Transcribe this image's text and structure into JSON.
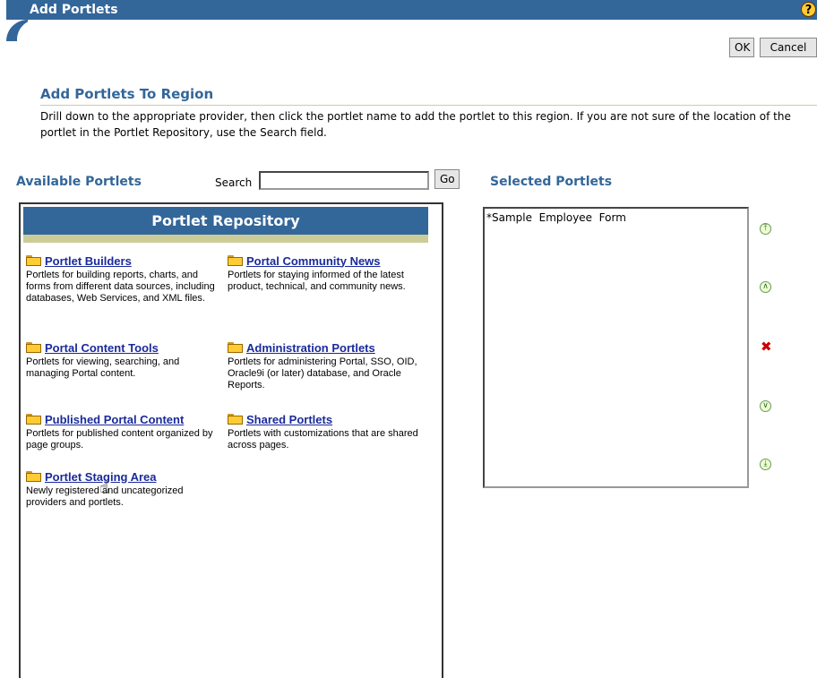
{
  "dialog": {
    "title": "Add Portlets",
    "help_glyph": "?"
  },
  "buttons": {
    "ok": "OK",
    "cancel": "Cancel",
    "go": "Go"
  },
  "section": {
    "title": "Add Portlets To Region",
    "instructions": "Drill down to the appropriate provider, then click the portlet name to add the portlet to this region. If you are not sure of the location of the portlet in the Portlet Repository, use the Search field."
  },
  "available": {
    "label": "Available Portlets",
    "search_label": "Search",
    "search_value": ""
  },
  "repository": {
    "header": "Portlet Repository",
    "providers": [
      {
        "name": "Portlet Builders",
        "desc": "Portlets for building reports, charts, and forms from different data sources, including databases, Web Services, and XML files."
      },
      {
        "name": "Portal Community News",
        "desc": "Portlets for staying informed of the latest product, technical, and community news."
      },
      {
        "name": "Portal Content Tools",
        "desc": "Portlets for viewing, searching, and managing Portal content."
      },
      {
        "name": "Administration Portlets",
        "desc": "Portlets for administering Portal, SSO, OID, Oracle9i (or later) database, and Oracle Reports."
      },
      {
        "name": "Published Portal Content",
        "desc": "Portlets for published content organized by page groups."
      },
      {
        "name": "Shared Portlets",
        "desc": "Portlets with customizations that are shared across pages."
      },
      {
        "name": "Portlet Staging Area",
        "desc": "Newly registered and uncategorized providers and portlets."
      }
    ]
  },
  "selected": {
    "label": "Selected Portlets",
    "items": [
      "*Sample  Employee  Form"
    ]
  },
  "move_controls": {
    "top": "⤒",
    "up": "∧",
    "remove": "✖",
    "down": "∨",
    "bottom": "⤓"
  },
  "colors": {
    "brand": "#336699",
    "accent_bar": "#cccc99",
    "link": "#1a2a9a",
    "remove": "#cc0000"
  },
  "icons": {
    "provider": "folder-icon",
    "pointer": "hand-cursor-icon"
  }
}
